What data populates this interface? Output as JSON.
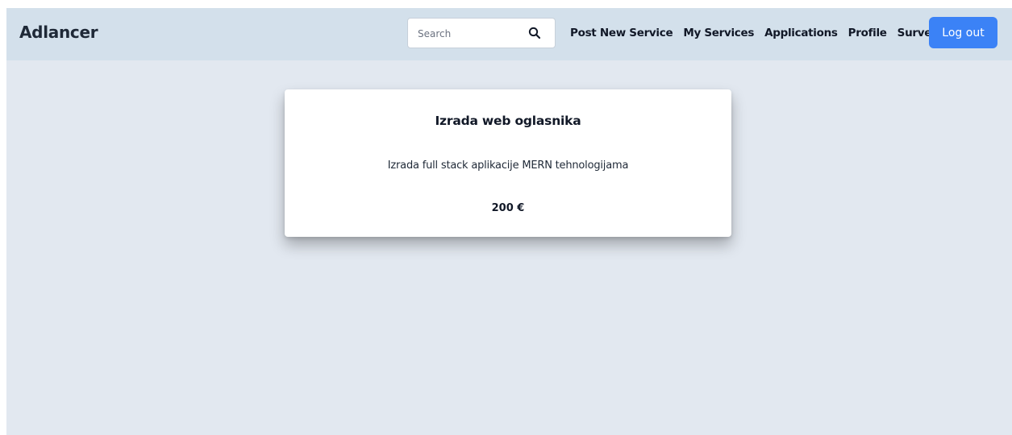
{
  "navbar": {
    "brand": "Adlancer",
    "search": {
      "placeholder": "Search",
      "value": "",
      "icon": "search-icon"
    },
    "links": [
      {
        "label": "Post New Service"
      },
      {
        "label": "My Services"
      },
      {
        "label": "Applications"
      },
      {
        "label": "Profile"
      },
      {
        "label": "Survey"
      }
    ],
    "logout_label": "Log out"
  },
  "service": {
    "title": "Izrada web oglasnika",
    "description": "Izrada full stack aplikacije MERN tehnologijama",
    "price": "200 €"
  },
  "colors": {
    "navbar_bg": "#d3e0eb",
    "page_bg": "#e2e8f0",
    "accent": "#3b82f6"
  }
}
